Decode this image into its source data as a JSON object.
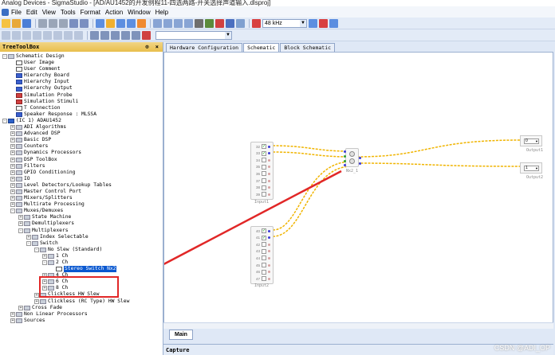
{
  "window": {
    "title": "Analog Devices - SigmaStudio - [AD/AU1452的开发例程11-四选两路-开关选择声道输入.dlsproj]"
  },
  "menu": [
    "File",
    "Edit",
    "View",
    "Tools",
    "Format",
    "Action",
    "Window",
    "Help"
  ],
  "toolbar": {
    "sample_rate": "48 kHz"
  },
  "tree": {
    "title": "TreeToolBox",
    "header_controls": "⊙ ×",
    "items": [
      "Schematic Design",
      "User Image",
      "User Comment",
      "Hierarchy Board",
      "Hierarchy Input",
      "Hierarchy Output",
      "Simulation Probe",
      "Simulation Stimuli",
      "T Connection",
      "Speaker Response : MLSSA",
      "(IC 1) ADAU1452",
      "ADI Algorithms",
      "Advanced DSP",
      "Basic DSP",
      "Counters",
      "Dynamics Processors",
      "DSP ToolBox",
      "Filters",
      "GPIO Conditioning",
      "IO",
      "Level Detectors/Lookup Tables",
      "Master Control Port",
      "Mixers/Splitters",
      "Multirate Processing",
      "Muxes/Demuxes",
      "State Machine",
      "Demultiplexers",
      "Multiplexers",
      "Index Selectable",
      "Switch",
      "No Slew (Standard)",
      "1 Ch",
      "2 Ch",
      "Stereo Switch Nx2",
      "4 Ch",
      "6 Ch",
      "8 Ch",
      "Clickless HW Slew",
      "Clickless (RC Type) HW Slew",
      "Cross Fade",
      "Non Linear Processors",
      "Sources"
    ]
  },
  "tabs": [
    "Hardware Configuration",
    "Schematic",
    "Block Schematic"
  ],
  "schematic": {
    "input1": {
      "label": "Input1",
      "pins": [
        "32",
        "33",
        "34",
        "35",
        "36",
        "37",
        "38",
        "39"
      ],
      "checked": [
        true,
        true,
        false,
        false,
        false,
        false,
        false,
        false
      ]
    },
    "input2": {
      "label": "Input2",
      "pins": [
        "40",
        "41",
        "42",
        "43",
        "44",
        "45",
        "46",
        "47"
      ],
      "checked": [
        true,
        true,
        false,
        false,
        false,
        false,
        false,
        false
      ]
    },
    "switch_label": "Nx2_1",
    "output1": {
      "label": "Output1",
      "value": "0"
    },
    "output2": {
      "label": "Output2",
      "value": "1"
    }
  },
  "bottom": {
    "main_tab": "Main",
    "capture_label": "Capture",
    "watermark": "CSDN @ADI_OP"
  }
}
